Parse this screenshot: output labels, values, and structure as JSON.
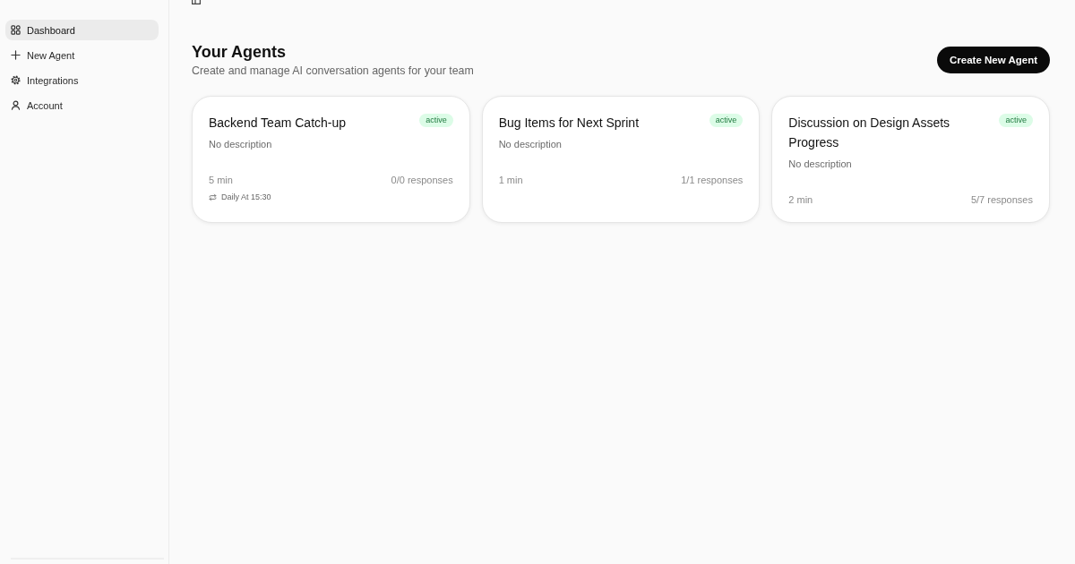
{
  "sidebar": {
    "items": [
      {
        "label": "Dashboard",
        "selected": true
      },
      {
        "label": "New Agent",
        "selected": false
      },
      {
        "label": "Integrations",
        "selected": false
      },
      {
        "label": "Account",
        "selected": false
      }
    ]
  },
  "header": {
    "title": "Your Agents",
    "subtitle": "Create and manage AI conversation agents for your team",
    "button": "Create New Agent"
  },
  "agents": [
    {
      "title": "Backend Team Catch-up",
      "status": "active",
      "description": "No description",
      "duration": "5 min",
      "responses": "0/0 responses",
      "schedule": "Daily At 15:30"
    },
    {
      "title": "Bug Items for Next Sprint",
      "status": "active",
      "description": "No description",
      "duration": "1 min",
      "responses": "1/1 responses"
    },
    {
      "title": "Discussion on Design Assets Progress",
      "status": "active",
      "description": "No description",
      "duration": "2 min",
      "responses": "5/7 responses"
    }
  ]
}
